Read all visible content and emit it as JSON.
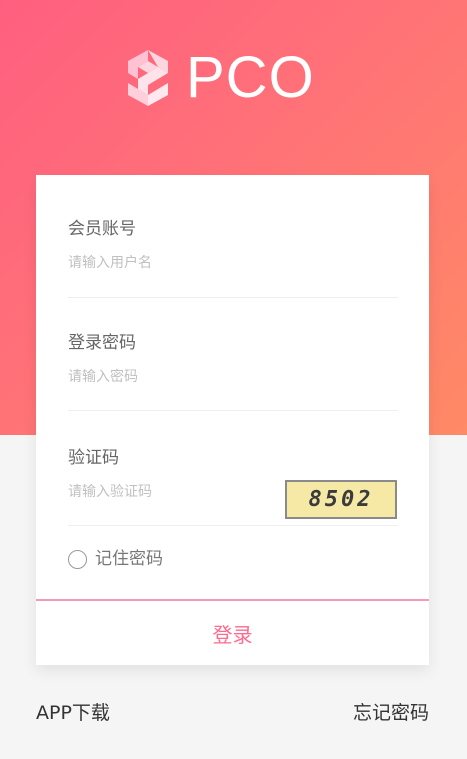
{
  "logo": {
    "text": "PCO"
  },
  "form": {
    "account": {
      "label": "会员账号",
      "placeholder": "请输入用户名"
    },
    "password": {
      "label": "登录密码",
      "placeholder": "请输入密码"
    },
    "captcha": {
      "label": "验证码",
      "placeholder": "请输入验证码",
      "image_text": "8502"
    },
    "remember_label": "记住密码",
    "login_label": "登录"
  },
  "footer": {
    "app_download": "APP下载",
    "forgot_password": "忘记密码"
  },
  "colors": {
    "gradient_start": "#ff5f7f",
    "gradient_end": "#ff8a66",
    "accent": "#ff6a8f"
  }
}
